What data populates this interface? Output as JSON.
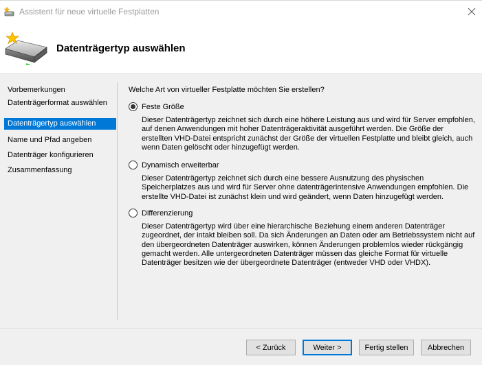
{
  "window": {
    "title": "Assistent für neue virtuelle Festplatten",
    "close_glyph": "✕"
  },
  "header": {
    "page_title": "Datenträgertyp auswählen",
    "icon": "hard-disk-icon"
  },
  "nav": {
    "items": [
      {
        "label": "Vorbemerkungen",
        "active": false
      },
      {
        "label": "Datenträgerformat auswählen",
        "active": false
      },
      {
        "label": "Datenträgertyp auswählen",
        "active": true
      },
      {
        "label": "Name und Pfad angeben",
        "active": false
      },
      {
        "label": "Datenträger konfigurieren",
        "active": false
      },
      {
        "label": "Zusammenfassung",
        "active": false
      }
    ]
  },
  "content": {
    "question": "Welche Art von virtueller Festplatte möchten Sie erstellen?",
    "options": [
      {
        "label": "Feste Größe",
        "selected": true,
        "description": "Dieser Datenträgertyp zeichnet sich durch eine höhere Leistung aus und wird für Server empfohlen, auf denen Anwendungen mit hoher Datenträgeraktivität ausgeführt werden. Die Größe der erstellten VHD-Datei entspricht zunächst der Größe der virtuellen Festplatte und bleibt gleich, auch wenn Daten gelöscht oder hinzugefügt werden."
      },
      {
        "label": "Dynamisch erweiterbar",
        "selected": false,
        "description": "Dieser Datenträgertyp zeichnet sich durch eine bessere Ausnutzung des physischen Speicherplatzes aus und wird für Server ohne datenträgerintensive Anwendungen empfohlen. Die erstellte VHD-Datei ist zunächst klein und wird geändert, wenn Daten hinzugefügt werden."
      },
      {
        "label": "Differenzierung",
        "selected": false,
        "description": "Dieser Datenträgertyp wird über eine hierarchische Beziehung einem anderen Datenträger zugeordnet, der intakt bleiben soll. Da sich Änderungen an Daten oder am Betriebssystem nicht auf den übergeordneten Datenträger auswirken, können Änderungen problemlos wieder rückgängig gemacht werden. Alle untergeordneten Datenträger müssen das gleiche Format für virtuelle Datenträger besitzen wie der übergeordnete Datenträger (entweder VHD oder VHDX)."
      }
    ]
  },
  "footer": {
    "back_label": "< Zurück",
    "next_label": "Weiter >",
    "finish_label": "Fertig stellen",
    "cancel_label": "Abbrechen"
  },
  "colors": {
    "accent": "#0078d7",
    "body_bg": "#f0f0f0",
    "button_bg": "#e1e1e1"
  }
}
